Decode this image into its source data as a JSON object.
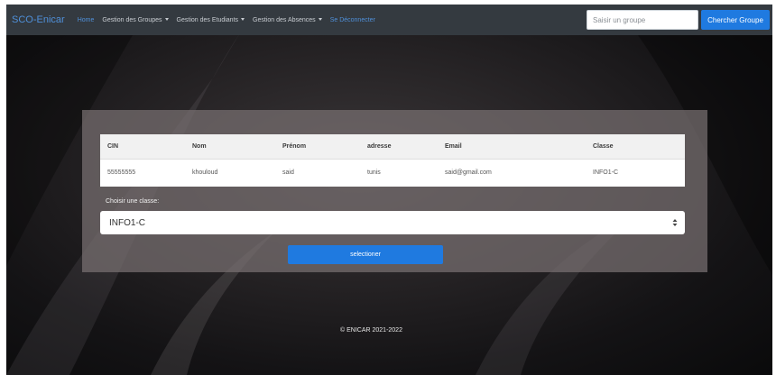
{
  "navbar": {
    "brand": "SCO-Enicar",
    "links": [
      {
        "label": "Home",
        "dropdown": false
      },
      {
        "label": "Gestion des Groupes",
        "dropdown": true
      },
      {
        "label": "Gestion des Etudiants",
        "dropdown": true
      },
      {
        "label": "Gestion des Absences",
        "dropdown": true
      },
      {
        "label": "Se Déconnecter",
        "dropdown": false
      }
    ],
    "search_placeholder": "Saisir un groupe",
    "search_button": "Chercher Groupe"
  },
  "student_table": {
    "columns": [
      "CIN",
      "Nom",
      "Prénom",
      "adresse",
      "Email",
      "Classe"
    ],
    "rows": [
      [
        "55555555",
        "khouloud",
        "said",
        "tunis",
        "said@gmail.com",
        "INFO1-C"
      ]
    ]
  },
  "class_form": {
    "label": "Choisir une classe:",
    "selected": "INFO1-C",
    "submit": "selectioner"
  },
  "footer": "© ENICAR 2021-2022",
  "colors": {
    "accent": "#1f7ae0",
    "link": "#4f8fd8",
    "navbar": "#343a40"
  }
}
